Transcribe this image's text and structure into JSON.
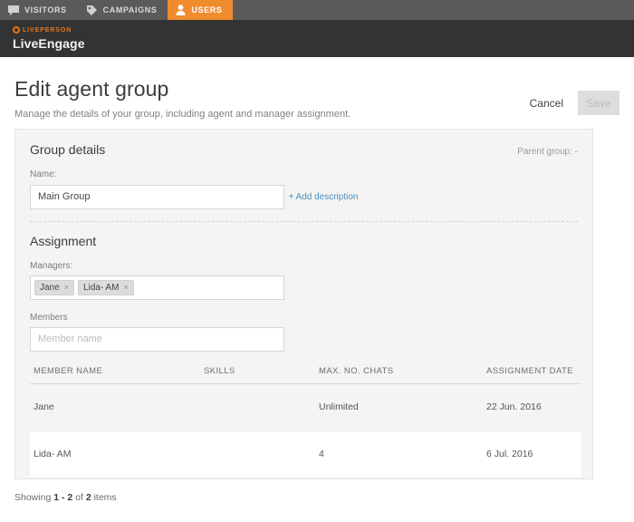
{
  "nav": {
    "tabs": [
      {
        "label": "VISITORS",
        "icon": "chat-bubble-icon",
        "active": false
      },
      {
        "label": "CAMPAIGNS",
        "icon": "tag-icon",
        "active": false
      },
      {
        "label": "USERS",
        "icon": "user-icon",
        "active": true
      }
    ],
    "active_color": "#f08c2e",
    "bar_color": "#5a5a5a"
  },
  "brand": {
    "company": "LIVEPERSON",
    "product": "LiveEngage",
    "accent": "#e8761a",
    "bar_color": "#333333"
  },
  "header": {
    "title": "Edit agent group",
    "subtitle": "Manage the details of your group, including agent and manager assignment.",
    "cancel_label": "Cancel",
    "save_label": "Save",
    "save_disabled": true
  },
  "group_details": {
    "section_title": "Group details",
    "parent_group": "Parent group: -",
    "name_label": "Name:",
    "name_value": "Main Group",
    "name_placeholder": "",
    "add_description_label": "+ Add description",
    "link_color": "#4a8fc0"
  },
  "assignment": {
    "section_title": "Assignment",
    "managers_label": "Managers:",
    "managers": [
      {
        "name": "Jane",
        "remove": "×"
      },
      {
        "name": "Lida- AM",
        "remove": "×"
      }
    ],
    "members_label": "Members",
    "members_placeholder": "Member name",
    "members_value": ""
  },
  "table": {
    "columns": [
      "MEMBER NAME",
      "SKILLS",
      "MAX. NO. CHATS",
      "ASSIGNMENT DATE"
    ],
    "rows": [
      {
        "member_name": "Jane",
        "skills": "",
        "max_no_chats": "Unlimited",
        "assignment_date": "22 Jun. 2016"
      },
      {
        "member_name": "Lida- AM",
        "skills": "",
        "max_no_chats": "4",
        "assignment_date": "6 Jul. 2016"
      }
    ]
  },
  "footer": {
    "showing_prefix": "Showing ",
    "range": "1 - 2",
    "of": " of ",
    "total": "2",
    "suffix": " items"
  }
}
